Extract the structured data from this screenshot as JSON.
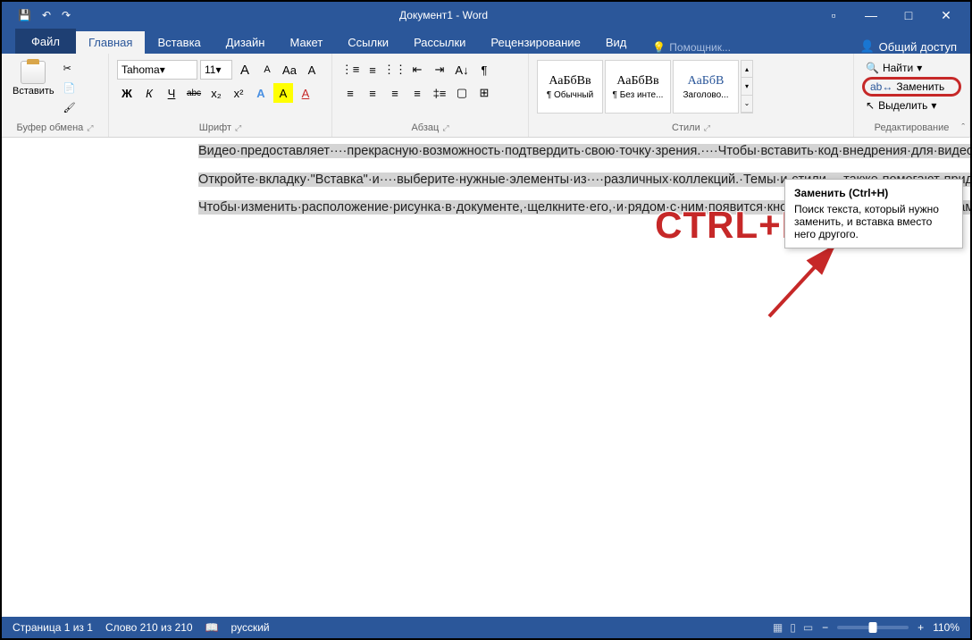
{
  "titlebar": {
    "save_icon": "💾",
    "undo_icon": "↶",
    "redo_icon": "↷",
    "title": "Документ1 - Word",
    "ribbon_opts": "▫",
    "minimize": "—",
    "maximize": "□",
    "close": "✕"
  },
  "tabs": {
    "file": "Файл",
    "home": "Главная",
    "insert": "Вставка",
    "design": "Дизайн",
    "layout": "Макет",
    "references": "Ссылки",
    "mailings": "Рассылки",
    "review": "Рецензирование",
    "view": "Вид",
    "tell_me": "Помощник...",
    "share": "Общий доступ"
  },
  "clipboard": {
    "paste": "Вставить",
    "cut_icon": "✂",
    "copy_icon": "📄",
    "painter_icon": "🖌",
    "group_label": "Буфер обмена"
  },
  "font": {
    "name": "Tahoma",
    "size": "11",
    "grow": "A",
    "shrink": "A",
    "case": "Aa",
    "clear": "A",
    "bold": "Ж",
    "italic": "К",
    "underline": "Ч",
    "strike": "abc",
    "sub": "x₂",
    "sup": "x²",
    "effects": "A",
    "highlight": "A",
    "color": "A",
    "group_label": "Шрифт"
  },
  "paragraph": {
    "group_label": "Абзац"
  },
  "styles": {
    "item1_prev": "АаБбВв",
    "item1_label": "¶ Обычный",
    "item2_prev": "АаБбВв",
    "item2_label": "¶ Без инте...",
    "item3_prev": "АаБбВ",
    "item3_label": "Заголово...",
    "group_label": "Стили"
  },
  "editing": {
    "find": "Найти",
    "replace": "Заменить",
    "select": "Выделить",
    "group_label": "Редактирование"
  },
  "annotation": {
    "shortcut": "CTRL+H"
  },
  "tooltip": {
    "title": "Заменить (Ctrl+H)",
    "body": "Поиск текста, который нужно заменить, и вставка вместо него другого."
  },
  "document": {
    "p1": "Видео·предоставляет····прекрасную·возможность·подтвердить·свою·точку·зрения.····Чтобы·вставить·код·внедрения·для·видео,·которое·вы·хотите·добавить,·нажмите·\"Видео·в·сети\".···Вы·также·можете·ввести·ключевое·слово,····чтобы·найти·в·Интернете·видео,·которое····лучше·всего·подходит····для·вашего·документа.·Чтобы·придать·документу·профессиональный·вид,·воспользуйтесь····доступными·в·Word····верхних·и·нижних·колонтитулов,····титульной·страницы·и·текстовых·полей,·которые····дополняют·друг·друга.·Например,····вы·можете·добавить····подходящую·титульную·страницу,·верхний····колонтитул·и·боковое·примечание.·¶",
    "p2": "Откройте·вкладку·\"Вставка\"·и····выберите·нужные·элементы·из····различных·коллекций.·Темы·и·стили····также·помогают·придать·документу·единообразный·вид.····Если·на·вкладке·\"Конструктор\"·выбрать·другую·тему,····то·изображения,·диаграммы·и·графические·элементы·SmartArt····изменятся·соответствующим·образом.····При·применении·стилей·заголовки·изменяются·в·соответствии····с·новой·темой.·Новые·кнопки,·которые·видны,·только·если·они·действительно·нужны,·экономят·время·при·работе·в·Word.¶",
    "p3": "Чтобы·изменить·расположение·рисунка·в·документе,·щелкните·его,·и·рядом·с·ним·появится·кнопка·для·доступа·к·параметрам·разметки.·При·работе·с·таблицей·щелкните·то·место,·куда·нужно·добавить·строку·или·столбец,·и·щелкните·знак·\"плюс\".·Читать·тоже·стало·проще·благодаря·новому·режиму·чтения.·Можно·свернуть·части·документа,·чтобы·сосредоточиться·на·нужном·фрагменте·текста.·Если·вы·прервете·чтение,·не·дойдя·до·конца·документа,·Word·запомнит,·в·каком·месте·вы·остановились·(даже·на·другом·устройстве).¶"
  },
  "statusbar": {
    "page": "Страница 1 из 1",
    "words": "Слово 210 из 210",
    "lang": "русский",
    "zoom": "110%"
  }
}
